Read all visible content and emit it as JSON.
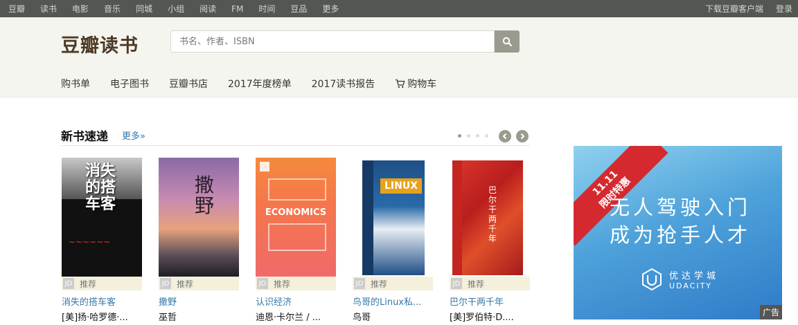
{
  "topbar": {
    "left": [
      "豆瓣",
      "读书",
      "电影",
      "音乐",
      "同城",
      "小组",
      "阅读",
      "FM",
      "时间",
      "豆品",
      "更多"
    ],
    "download": "下载豆瓣客户端",
    "login": "登录"
  },
  "header": {
    "logo": "豆瓣读书",
    "search_placeholder": "书名、作者、ISBN"
  },
  "subnav": [
    "购书单",
    "电子图书",
    "豆瓣书店",
    "2017年度榜单",
    "2017读书报告",
    "购物车"
  ],
  "section": {
    "title": "新书速递",
    "more": "更多»"
  },
  "books": [
    {
      "title": "消失的搭车客",
      "author": "[美]扬·哈罗德·...",
      "badge": "推荐",
      "jd": "JD",
      "cover_text": "消失的搭车客"
    },
    {
      "title": "撒野",
      "author": "巫哲",
      "badge": "推荐",
      "jd": "JD",
      "cover_text": "撒野"
    },
    {
      "title": "认识经济",
      "author": "迪恩·卡尔兰 / ...",
      "badge": "推荐",
      "jd": "JD",
      "cover_text": "ECONOMICS"
    },
    {
      "title": "鸟哥的Linux私...",
      "author": "鸟哥",
      "badge": "推荐",
      "jd": "JD",
      "cover_text": "LINUX"
    },
    {
      "title": "巴尔干两千年",
      "author": "[美]罗伯特·D....",
      "badge": "推荐",
      "jd": "JD",
      "cover_text": "巴尔干两千年"
    }
  ],
  "ad": {
    "ribbon_top": "11.11",
    "ribbon_bottom": "限时特惠",
    "line1": "无人驾驶入门",
    "line2": "成为抢手人才",
    "brand_cn": "优达学城",
    "brand_en": "UDACITY",
    "tag": "广告"
  },
  "colors": {
    "topbar": "#545652",
    "header_bg": "#f5f5ef",
    "logo": "#4d3a26",
    "link": "#3377aa",
    "badge_bg": "#f4f0dc",
    "ad_ribbon": "#d42a2f"
  }
}
